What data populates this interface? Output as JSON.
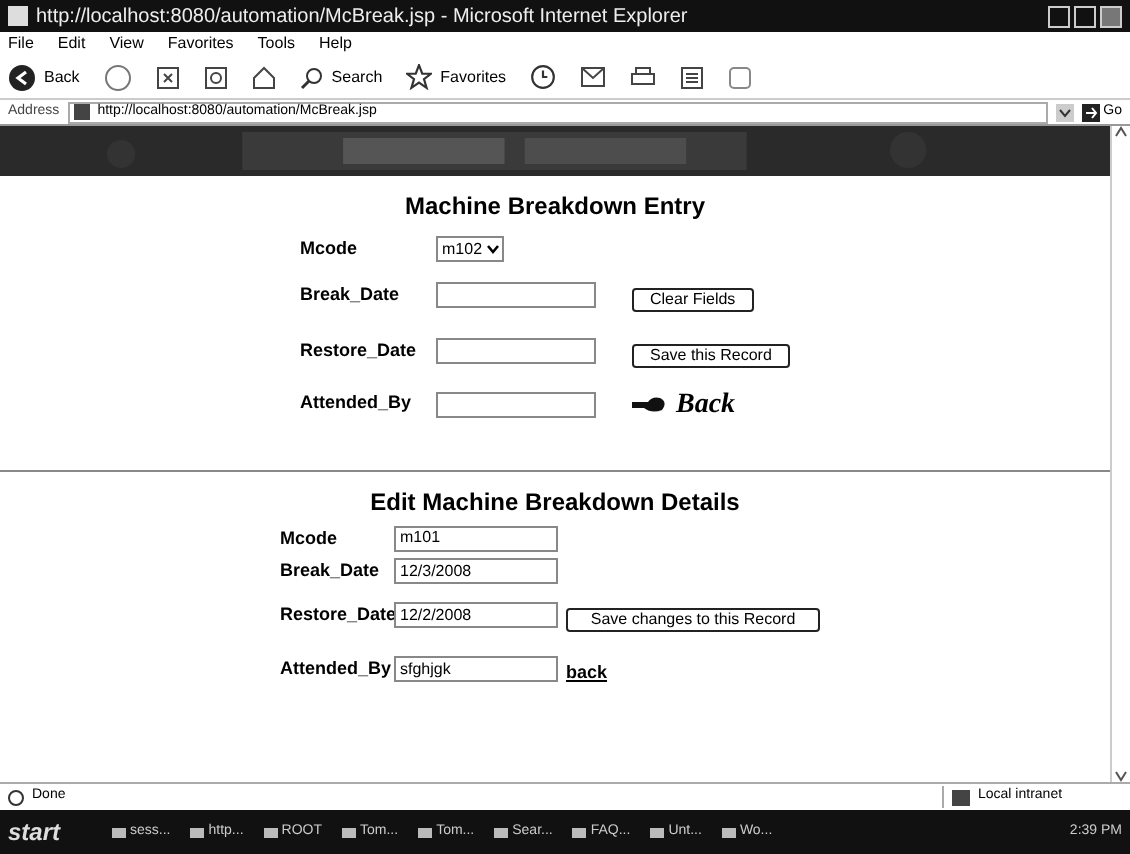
{
  "window": {
    "title": "http://localhost:8080/automation/McBreak.jsp - Microsoft Internet Explorer"
  },
  "menu": [
    "File",
    "Edit",
    "View",
    "Favorites",
    "Tools",
    "Help"
  ],
  "toolbar": {
    "back": "Back",
    "search": "Search",
    "favorites": "Favorites"
  },
  "address": {
    "label": "Address",
    "value": "http://localhost:8080/automation/McBreak.jsp",
    "go": "Go"
  },
  "entry": {
    "heading": "Machine Breakdown Entry",
    "rows": [
      {
        "label": "Mcode",
        "kind": "select",
        "value": "m102"
      },
      {
        "label": "Break_Date",
        "kind": "input",
        "value": "",
        "button": "Clear Fields"
      },
      {
        "label": "Restore_Date",
        "kind": "input",
        "value": "",
        "button": "Save this Record"
      },
      {
        "label": "Attended_By",
        "kind": "input",
        "value": "",
        "back": "Back"
      }
    ]
  },
  "edit": {
    "heading": "Edit Machine Breakdown Details",
    "rows": [
      {
        "label": "Mcode",
        "value": "m101"
      },
      {
        "label": "Break_Date",
        "value": "12/3/2008"
      },
      {
        "label": "Restore_Date",
        "value": "12/2/2008",
        "button": "Save changes to this Record"
      },
      {
        "label": "Attended_By",
        "value": "sfghjgk",
        "link": "back"
      }
    ]
  },
  "status_bar": {
    "status": "Done",
    "zone": "Local intranet"
  },
  "taskbar": {
    "start": "start",
    "items": [
      "sess...",
      "http...",
      "ROOT",
      "Tom...",
      "Tom...",
      "Sear...",
      "FAQ...",
      "Unt...",
      "Wo..."
    ],
    "clock": "2:39 PM"
  }
}
